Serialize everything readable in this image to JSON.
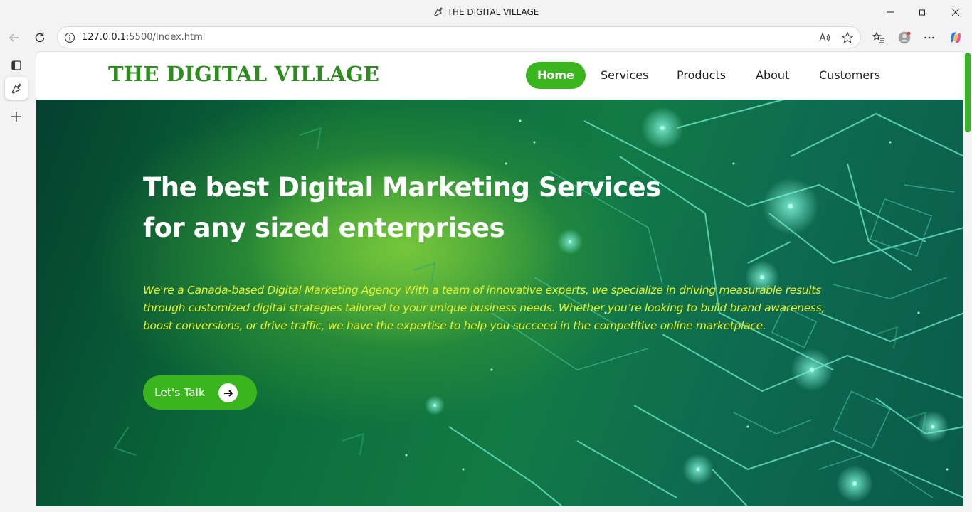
{
  "browser": {
    "window_title": "THE DIGITAL VILLAGE",
    "url_host": "127.0.0.1",
    "url_rest": ":5500/Index.html",
    "icons": [
      "back-icon",
      "refresh-icon",
      "info-icon",
      "read-aloud-icon",
      "favorite-star-icon",
      "favorites-icon",
      "profile-avatar",
      "more-icon",
      "copilot-icon",
      "minimize-icon",
      "restore-icon",
      "close-icon",
      "tab-actions-icon",
      "new-tab-icon"
    ]
  },
  "site": {
    "logo": "THE DIGITAL VILLAGE",
    "nav": [
      {
        "label": "Home"
      },
      {
        "label": "Services"
      },
      {
        "label": "Products"
      },
      {
        "label": "About"
      },
      {
        "label": "Customers"
      }
    ],
    "hero": {
      "headline_line1": "The best Digital Marketing Services",
      "headline_line2": "for any sized enterprises",
      "lead": "We're a Canada-based Digital Marketing Agency With a team of innovative experts, we specialize in driving measurable results through customized digital strategies tailored to your unique business needs. Whether you’re looking to build brand awareness, boost conversions, or drive traffic, we have the expertise to help you succeed in the competitive online marketplace.",
      "cta_label": "Let's Talk"
    }
  },
  "colors": {
    "brand_green": "#3ab51e",
    "logo_green": "#2e8b1f",
    "lead_yellow": "#e6f230"
  }
}
